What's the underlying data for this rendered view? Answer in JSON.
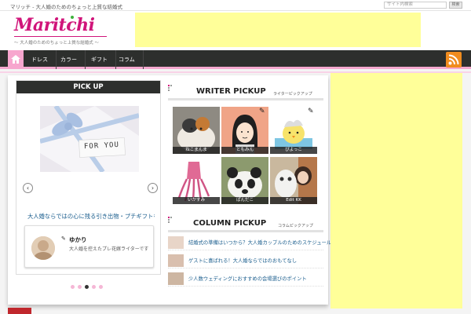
{
  "site": {
    "tagline": "マリッチ - 大人婚のためのちょっと上質な結婚式",
    "search_placeholder": "サイト内検索",
    "search_button": "検索",
    "logo_text": "Maritchi",
    "logo_subtitle": "～ 大人婚のためのちょっと上質な結婚式 ～"
  },
  "nav": {
    "items": [
      {
        "label": "ドレス"
      },
      {
        "label": "カラー"
      },
      {
        "label": "ギフト"
      },
      {
        "label": "コラム"
      }
    ]
  },
  "pickup": {
    "title": "PICK UP",
    "slide_image_text": "FOR YOU",
    "caption": "大人婚ならではの心に残る引き出物・プチギフトを選ぶコツ",
    "author": {
      "name": "ゆかり",
      "description": "大人婚を控えたプレ花嫁ライターです"
    },
    "dots": 5,
    "active_dot": 3
  },
  "writer_pickup": {
    "title": "WRITER PICKUP",
    "subtitle": "ライターピックアップ",
    "writers": [
      {
        "label": "ねこまんま"
      },
      {
        "label": "ともみん"
      },
      {
        "label": "ぴよっこ"
      },
      {
        "label": "いかすみ"
      },
      {
        "label": "ぱんだこ"
      },
      {
        "label": "Edit KK"
      }
    ]
  },
  "column_pickup": {
    "title": "COLUMN PICKUP",
    "subtitle": "コラムピックアップ",
    "items": [
      {
        "text": "結婚式の準備はいつから？大人婚カップルのためのスケジュール"
      },
      {
        "text": "ゲストに喜ばれる！大人婚ならではのおもてなし"
      },
      {
        "text": "少人数ウェディングにおすすめの会場選びのポイント"
      }
    ]
  },
  "colors": {
    "brand": "#d0157a",
    "nav_bg": "#2d2f2d",
    "accent_pink": "#f7a6ce",
    "ad_yellow": "#ffff99",
    "rss_orange": "#f08c1e",
    "link_blue": "#1b5e8e"
  }
}
